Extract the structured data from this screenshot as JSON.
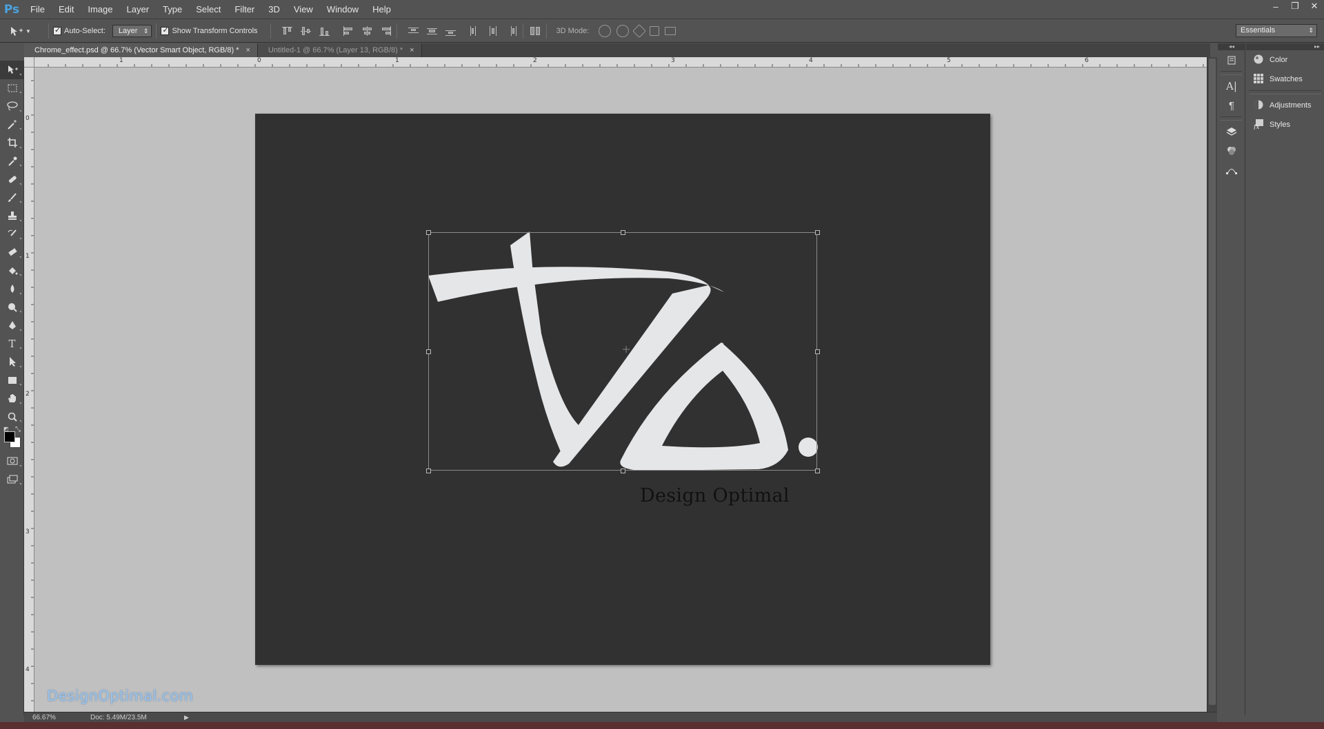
{
  "app": {
    "logo": "Ps"
  },
  "menu": [
    "File",
    "Edit",
    "Image",
    "Layer",
    "Type",
    "Select",
    "Filter",
    "3D",
    "View",
    "Window",
    "Help"
  ],
  "window_controls": {
    "minimize": "–",
    "restore": "❐",
    "close": "✕"
  },
  "options": {
    "auto_select_label": "Auto-Select:",
    "auto_select_checked": true,
    "auto_select_target": "Layer",
    "show_transform_label": "Show Transform Controls",
    "show_transform_checked": true,
    "mode_label": "3D Mode:",
    "workspace": "Essentials"
  },
  "tabs": [
    {
      "label": "Chrome_effect.psd @ 66.7% (Vector Smart Object, RGB/8) *",
      "active": true,
      "close": "×"
    },
    {
      "label": "Untitled-1 @ 66.7% (Layer 13, RGB/8) *",
      "active": false,
      "close": "×"
    }
  ],
  "tools": [
    "move-tool",
    "marquee-tool",
    "lasso-tool",
    "magic-wand-tool",
    "crop-tool",
    "eyedropper-tool",
    "healing-brush-tool",
    "brush-tool",
    "clone-stamp-tool",
    "history-brush-tool",
    "eraser-tool",
    "paint-bucket-tool",
    "blur-tool",
    "dodge-tool",
    "pen-tool",
    "type-tool",
    "path-selection-tool",
    "rectangle-tool",
    "hand-tool",
    "zoom-tool"
  ],
  "colors": {
    "foreground": "#000000",
    "background": "#ffffff",
    "accent": "#4aa3df"
  },
  "rulers": {
    "top_labels": [
      "1",
      "0",
      "1",
      "2",
      "3",
      "4",
      "5",
      "6"
    ],
    "left_labels": [
      "0",
      "1",
      "2",
      "3",
      "4"
    ]
  },
  "canvas": {
    "logo_caption": "Design Optimal",
    "watermark": "DesignOptimal.com"
  },
  "status": {
    "zoom": "66.67%",
    "doc": "Doc: 5.49M/23.5M",
    "arrow": "▶"
  },
  "panels": {
    "group1": [
      {
        "label": "Color",
        "icon": "color-icon"
      },
      {
        "label": "Swatches",
        "icon": "swatches-icon"
      }
    ],
    "group2": [
      {
        "label": "Adjustments",
        "icon": "adjustments-icon"
      },
      {
        "label": "Styles",
        "icon": "styles-icon"
      }
    ]
  }
}
